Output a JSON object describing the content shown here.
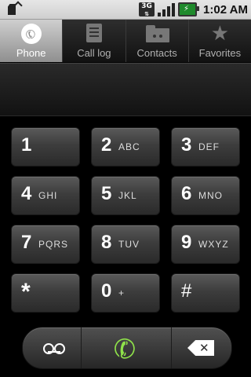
{
  "status_bar": {
    "time": "1:02 AM",
    "network_type": "3G",
    "icons": [
      "sd-card-icon",
      "usb-icon",
      "3g-icon",
      "signal-icon",
      "battery-charging-icon"
    ]
  },
  "tabs": [
    {
      "label": "Phone",
      "icon": "phone-icon",
      "active": true
    },
    {
      "label": "Call log",
      "icon": "call-log-icon",
      "active": false
    },
    {
      "label": "Contacts",
      "icon": "contacts-icon",
      "active": false
    },
    {
      "label": "Favorites",
      "icon": "star-icon",
      "active": false
    }
  ],
  "display": {
    "number": ""
  },
  "keypad": [
    {
      "digit": "1",
      "letters": ""
    },
    {
      "digit": "2",
      "letters": "ABC"
    },
    {
      "digit": "3",
      "letters": "DEF"
    },
    {
      "digit": "4",
      "letters": "GHI"
    },
    {
      "digit": "5",
      "letters": "JKL"
    },
    {
      "digit": "6",
      "letters": "MNO"
    },
    {
      "digit": "7",
      "letters": "PQRS"
    },
    {
      "digit": "8",
      "letters": "TUV"
    },
    {
      "digit": "9",
      "letters": "WXYZ"
    },
    {
      "digit": "*",
      "letters": ""
    },
    {
      "digit": "0",
      "letters": "+"
    },
    {
      "digit": "#",
      "letters": ""
    }
  ],
  "actions": {
    "voicemail_icon": "voicemail-icon",
    "call_icon": "call-icon",
    "delete_icon": "backspace-icon",
    "call_color": "#8fe24a"
  }
}
